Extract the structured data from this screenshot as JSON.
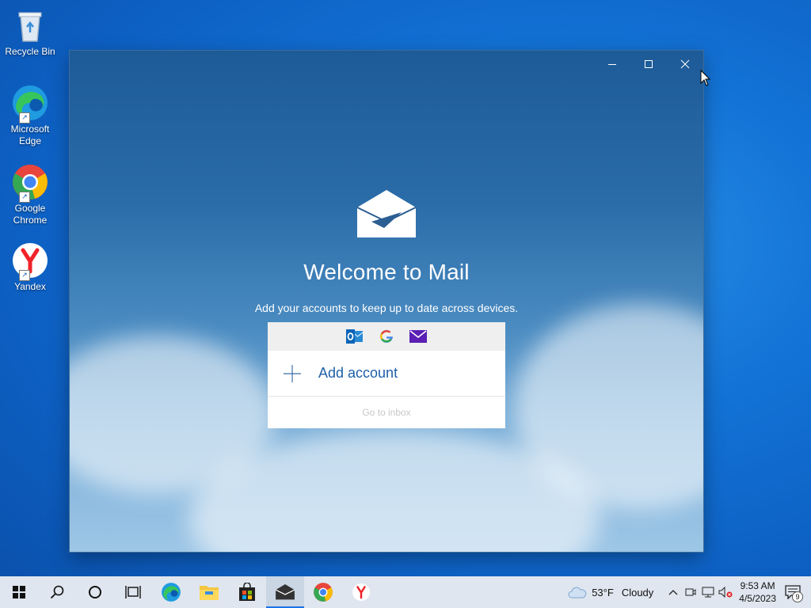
{
  "desktop": {
    "icons": [
      {
        "label": "Recycle Bin"
      },
      {
        "label": "Microsoft Edge"
      },
      {
        "label": "Google Chrome"
      },
      {
        "label": "Yandex"
      }
    ]
  },
  "mail": {
    "title": "Welcome to Mail",
    "subtitle": "Add your accounts to keep up to date across devices.",
    "add_account": "Add account",
    "go_to_inbox": "Go to inbox",
    "providers": [
      "outlook-icon",
      "google-icon",
      "yahoo-mail-icon"
    ]
  },
  "window_controls": {
    "minimize": "minimize",
    "maximize": "maximize",
    "close": "close"
  },
  "taskbar": {
    "weather_temp": "53°F",
    "weather_text": "Cloudy",
    "time": "9:53 AM",
    "date": "4/5/2023",
    "notification_count": "9",
    "colors": {
      "accent": "#1a73e8",
      "taskbar_bg": "#dfe6ef"
    }
  }
}
